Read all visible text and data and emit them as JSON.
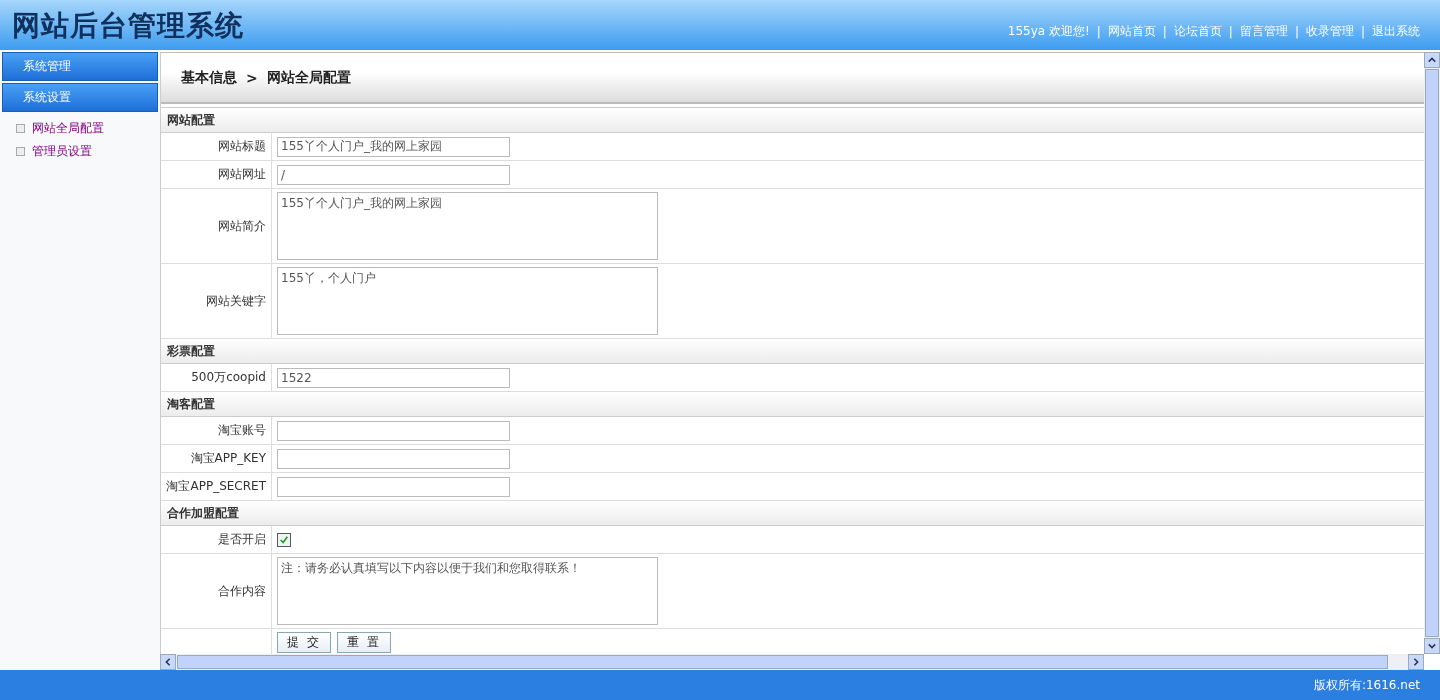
{
  "header": {
    "title": "网站后台管理系统",
    "welcome": "155ya 欢迎您!",
    "links": [
      {
        "separator": "|",
        "label": "网站首页"
      },
      {
        "separator": "|",
        "label": "论坛首页"
      },
      {
        "separator": "|",
        "label": "留言管理"
      },
      {
        "separator": "|",
        "label": "收录管理"
      },
      {
        "separator": "|",
        "label": "退出系统"
      }
    ]
  },
  "sidebar": {
    "menus": [
      {
        "label": "系统管理"
      },
      {
        "label": "系统设置"
      }
    ],
    "links": [
      {
        "label": "网站全局配置"
      },
      {
        "label": "管理员设置"
      }
    ]
  },
  "breadcrumb": {
    "items": [
      "基本信息",
      "网站全局配置"
    ],
    "separator": ">"
  },
  "sections": [
    {
      "title": "网站配置",
      "fields": [
        {
          "label": "网站标题",
          "kind": "text",
          "value": "155丫个人门户_我的网上家园"
        },
        {
          "label": "网站网址",
          "kind": "text",
          "value": "/"
        },
        {
          "label": "网站简介",
          "kind": "textarea",
          "value": "155丫个人门户_我的网上家园"
        },
        {
          "label": "网站关键字",
          "kind": "textarea",
          "value": "155丫，个人门户"
        }
      ]
    },
    {
      "title": "彩票配置",
      "fields": [
        {
          "label": "500万coopid",
          "kind": "text",
          "value": "1522"
        }
      ]
    },
    {
      "title": "淘客配置",
      "fields": [
        {
          "label": "淘宝账号",
          "kind": "text"
        },
        {
          "label": "淘宝APP_KEY",
          "kind": "text"
        },
        {
          "label": "淘宝APP_SECRET",
          "kind": "text"
        }
      ]
    },
    {
      "title": "合作加盟配置",
      "fields": [
        {
          "label": "是否开启",
          "kind": "checkbox",
          "checked": true
        },
        {
          "label": "合作内容",
          "kind": "textarea",
          "value": "注：请务必认真填写以下内容以便于我们和您取得联系！"
        }
      ]
    }
  ],
  "buttons": [
    "提 交",
    "重 置"
  ],
  "footer": "版权所有:1616.net"
}
